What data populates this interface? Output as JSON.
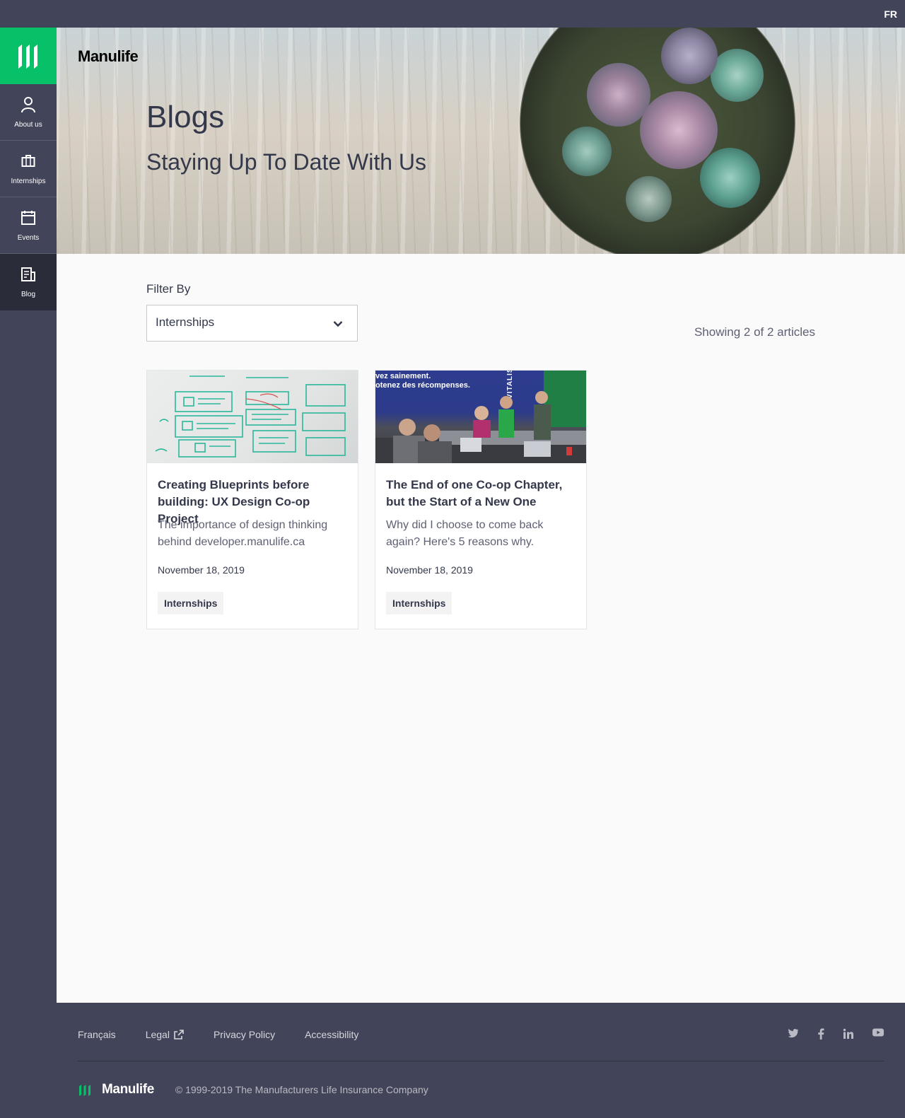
{
  "top_bar": {
    "language_toggle": "FR"
  },
  "sidebar": {
    "brand_color": "#06c167",
    "items": [
      {
        "label": "About us",
        "icon": "person-icon"
      },
      {
        "label": "Internships",
        "icon": "briefcase-icon"
      },
      {
        "label": "Events",
        "icon": "calendar-icon"
      },
      {
        "label": "Blog",
        "icon": "newspaper-icon",
        "active": true
      }
    ]
  },
  "hero": {
    "logo": "Manulife",
    "title": "Blogs",
    "subtitle": "Staying Up To Date With Us"
  },
  "filter": {
    "label": "Filter By",
    "selected": "Internships",
    "results_text": "Showing 2 of 2 articles"
  },
  "articles": [
    {
      "title": "Creating Blueprints before building: UX Design Co-op Project",
      "excerpt": "The importance of design thinking behind developer.manulife.ca",
      "date": "November 18, 2019",
      "tag": "Internships"
    },
    {
      "title": "The End of one Co-op Chapter, but the Start of a New One",
      "excerpt": "Why did I choose to come back again? Here's 5 reasons why.",
      "date": "November 18, 2019",
      "tag": "Internships",
      "image_text": {
        "line1": "vez sainement.",
        "line2": "otenez des récompenses.",
        "line3": "VITALIS"
      }
    }
  ],
  "footer": {
    "links": [
      "Français",
      "Legal",
      "Privacy Policy",
      "Accessibility"
    ],
    "social": [
      "twitter-icon",
      "facebook-icon",
      "linkedin-icon",
      "youtube-icon"
    ],
    "wordmark": "Manulife",
    "copyright": "© 1999-2019 The Manufacturers Life Insurance Company"
  },
  "colors": {
    "nav_dark": "#424559",
    "nav_active": "#2a2c3a",
    "accent_green": "#06c167",
    "text": "#34384b"
  }
}
